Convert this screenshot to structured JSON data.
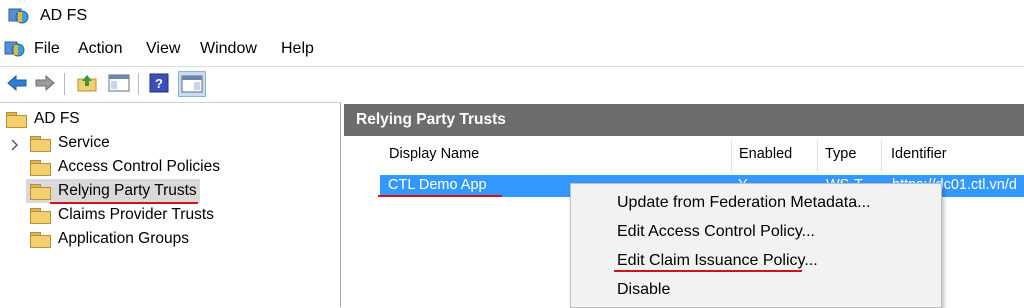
{
  "window": {
    "title": "AD FS"
  },
  "menu": [
    "File",
    "Action",
    "View",
    "Window",
    "Help"
  ],
  "toolbar": {
    "buttons": [
      "back-icon",
      "forward-icon",
      "up-folder-icon",
      "show-hide-console-tree-icon",
      "help-icon",
      "show-hide-action-pane-icon"
    ]
  },
  "tree": {
    "root": "AD FS",
    "items": [
      {
        "label": "Service",
        "expandable": true
      },
      {
        "label": "Access Control Policies"
      },
      {
        "label": "Relying Party Trusts",
        "selected": true
      },
      {
        "label": "Claims Provider Trusts"
      },
      {
        "label": "Application Groups"
      }
    ]
  },
  "main": {
    "header": "Relying Party Trusts",
    "columns": [
      "Display Name",
      "Enabled",
      "Type",
      "Identifier"
    ],
    "rows": [
      {
        "display_name": "CTL Demo App",
        "enabled": "Y",
        "type": "WS-T",
        "identifier": "https://dc01.ctl.vn/d"
      }
    ]
  },
  "context_menu": {
    "items": [
      "Update from Federation Metadata...",
      "Edit Access Control Policy...",
      "Edit Claim Issuance Policy...",
      "Disable"
    ]
  },
  "colors": {
    "selection": "#3399ff",
    "pane_header": "#6d6d6d",
    "annotation_underline": "#d0121b",
    "folder": "#f3cf6d"
  }
}
